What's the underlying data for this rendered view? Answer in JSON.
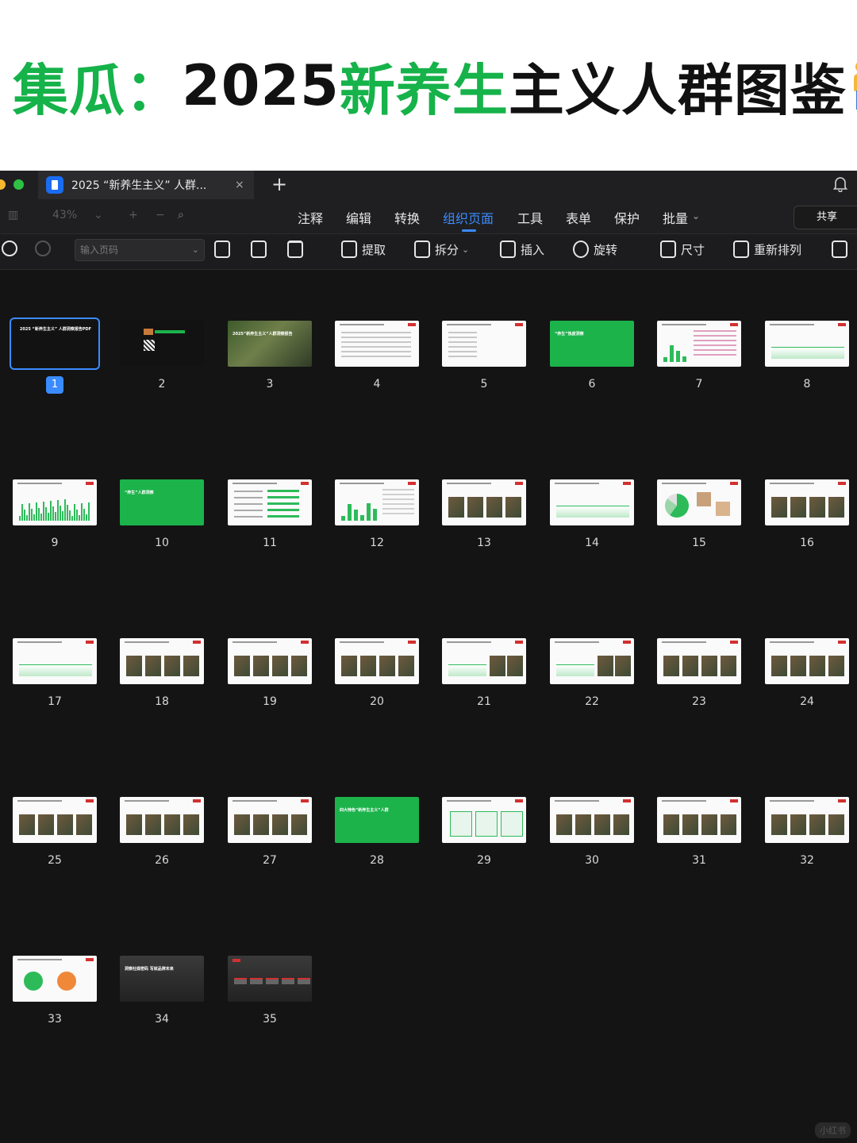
{
  "hero": {
    "title_part1": "集瓜：",
    "title_part2": "2025",
    "title_part3": "新养生",
    "title_part4": "主义人群图鉴"
  },
  "window": {
    "tab_title": "2025 “新养生主义” 人群...",
    "tab_close": "×",
    "new_tab": "+"
  },
  "toolbar": {
    "zoom": "43%",
    "menu": [
      "注释",
      "编辑",
      "转换",
      "组织页面",
      "工具",
      "表单",
      "保护",
      "批量"
    ],
    "active_menu": "组织页面",
    "share": "共享"
  },
  "organize": {
    "page_input_placeholder": "输入页码",
    "tools": [
      "提取",
      "拆分",
      "插入",
      "旋转",
      "尺寸",
      "重新排列"
    ]
  },
  "pages": [
    {
      "n": "1",
      "style": "dark-text",
      "title": "2025 “新养生主义” 人群洞察报告PDF"
    },
    {
      "n": "2",
      "style": "dark-qr"
    },
    {
      "n": "3",
      "style": "photo",
      "title": "2025“新养生主义”人群洞察报告"
    },
    {
      "n": "4",
      "style": "text"
    },
    {
      "n": "5",
      "style": "list"
    },
    {
      "n": "6",
      "style": "green",
      "title": "“养生”热度洞察"
    },
    {
      "n": "7",
      "style": "bars-right"
    },
    {
      "n": "8",
      "style": "line"
    },
    {
      "n": "9",
      "style": "bars"
    },
    {
      "n": "10",
      "style": "green",
      "title": "“养生”人群洞察"
    },
    {
      "n": "11",
      "style": "rows"
    },
    {
      "n": "12",
      "style": "bars-table"
    },
    {
      "n": "13",
      "style": "photos"
    },
    {
      "n": "14",
      "style": "line"
    },
    {
      "n": "15",
      "style": "pie"
    },
    {
      "n": "16",
      "style": "mixed"
    },
    {
      "n": "17",
      "style": "curves"
    },
    {
      "n": "18",
      "style": "photos-light"
    },
    {
      "n": "19",
      "style": "photos-light"
    },
    {
      "n": "20",
      "style": "photos-light"
    },
    {
      "n": "21",
      "style": "line-photos"
    },
    {
      "n": "22",
      "style": "line-photos"
    },
    {
      "n": "23",
      "style": "photos-light"
    },
    {
      "n": "24",
      "style": "photos"
    },
    {
      "n": "25",
      "style": "photos-light"
    },
    {
      "n": "26",
      "style": "photos-light"
    },
    {
      "n": "27",
      "style": "photos-light"
    },
    {
      "n": "28",
      "style": "green",
      "title": "四大特色“新养生主义”人群"
    },
    {
      "n": "29",
      "style": "diagram"
    },
    {
      "n": "30",
      "style": "photos-light"
    },
    {
      "n": "31",
      "style": "photos-light"
    },
    {
      "n": "32",
      "style": "photos-light"
    },
    {
      "n": "33",
      "style": "circles"
    },
    {
      "n": "34",
      "style": "grey",
      "title": "洞察社媒密码 写就品牌未来"
    },
    {
      "n": "35",
      "style": "grey-table"
    }
  ],
  "selected_page": "1",
  "watermark": "小红书",
  "colors": {
    "accent": "#3a8bff",
    "brand_green": "#16b24a",
    "background": "#141414"
  }
}
